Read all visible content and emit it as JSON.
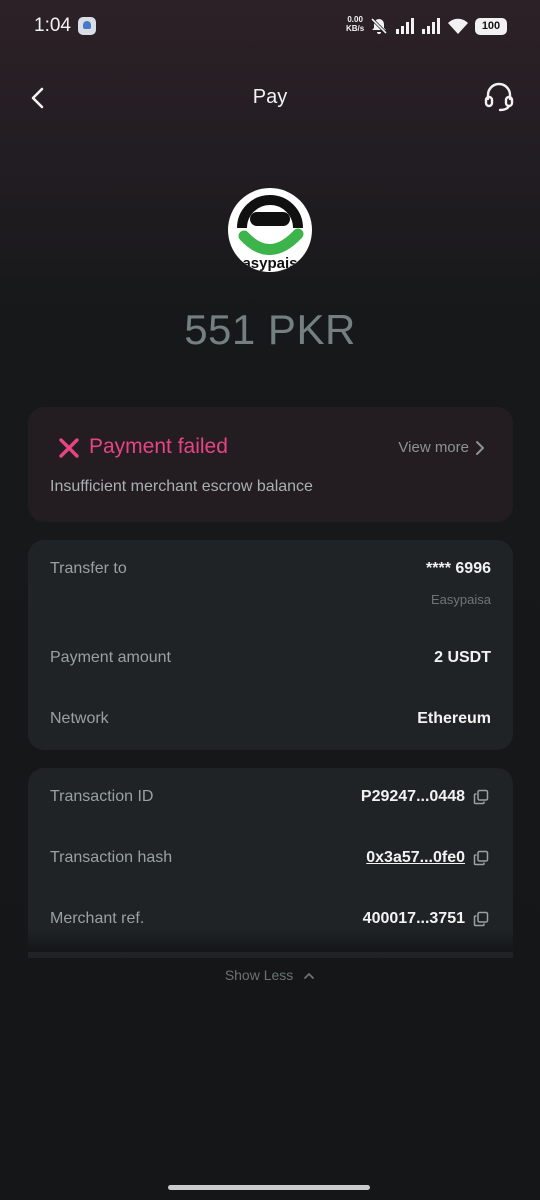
{
  "status_bar": {
    "time": "1:04",
    "net_speed_value": "0.00",
    "net_speed_unit": "KB/s",
    "battery": "100"
  },
  "header": {
    "title": "Pay"
  },
  "merchant": {
    "logo_text": "easypaisa",
    "amount": "551 PKR"
  },
  "status_card": {
    "title": "Payment failed",
    "view_more": "View more",
    "reason": "Insufficient merchant escrow balance",
    "accent_color": "#e6457f"
  },
  "details": {
    "transfer_to_label": "Transfer to",
    "transfer_to_value": "**** 6996",
    "transfer_to_sub": "Easypaisa",
    "payment_amount_label": "Payment amount",
    "payment_amount_value": "2 USDT",
    "network_label": "Network",
    "network_value": "Ethereum"
  },
  "transaction": {
    "id_label": "Transaction ID",
    "id_value": "P29247...0448",
    "hash_label": "Transaction hash",
    "hash_value": "0x3a57...0fe0",
    "merchant_ref_label": "Merchant ref.",
    "merchant_ref_value": "400017...3751"
  },
  "footer": {
    "show_less": "Show Less"
  },
  "icons": [
    "back-icon",
    "headset-icon",
    "close-x-icon",
    "chevron-right-icon",
    "copy-icon",
    "chevron-up-icon",
    "wifi-icon",
    "signal-icon",
    "mute-icon"
  ]
}
